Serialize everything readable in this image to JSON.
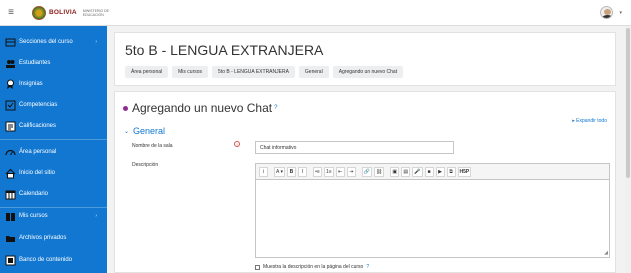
{
  "navbar": {
    "menu_icon": "hamburger-icon",
    "logo_text": "BOLIVIA",
    "logo_sub": "MINISTERIO DE EDUCACIÓN",
    "user_menu_caret": "▾"
  },
  "sidebar": {
    "items": [
      {
        "label": "Secciones del curso",
        "icon": "sections-icon",
        "has_caret": true
      },
      {
        "label": "Estudiantes",
        "icon": "students-icon"
      },
      {
        "label": "Insignias",
        "icon": "badge-icon"
      },
      {
        "label": "Competencias",
        "icon": "competencies-icon"
      },
      {
        "label": "Calificaciones",
        "icon": "grades-icon"
      },
      {
        "label": "Área personal",
        "icon": "dashboard-icon"
      },
      {
        "label": "Inicio del sitio",
        "icon": "home-icon"
      },
      {
        "label": "Calendario",
        "icon": "calendar-icon"
      },
      {
        "label": "Mis cursos",
        "icon": "courses-icon",
        "has_caret": true
      },
      {
        "label": "Archivos privados",
        "icon": "files-icon"
      },
      {
        "label": "Banco de contenido",
        "icon": "content-bank-icon"
      }
    ]
  },
  "header": {
    "course_title": "5to B - LENGUA EXTRANJERA",
    "breadcrumbs": [
      "Área personal",
      "Mis cursos",
      "5to B - LENGUA EXTRANJERA",
      "General",
      "Agregando un nuevo Chat"
    ]
  },
  "form": {
    "heading": "Agregando un nuevo Chat",
    "help_glyph": "?",
    "expand_all": "Expandir todo",
    "section_title": "General",
    "section_caret": "⌄",
    "room_name_label": "Nombre de la sala",
    "room_name_value": "Chat informativo",
    "required_glyph": "!",
    "description_label": "Descripción",
    "toolbar": [
      "i",
      "A ▾",
      "B",
      "I",
      "•≡",
      "1≡",
      "⇤",
      "⇥",
      "🔗",
      "⛓",
      "▣",
      "▤",
      "🎤",
      "■",
      "▶",
      "⧉",
      "H5P"
    ],
    "show_description_label": "Muestra la descripción en la página del curso"
  },
  "colors": {
    "brand": "#1177d1",
    "chat_dot": "#8e2d8e",
    "required": "#d9534f"
  }
}
